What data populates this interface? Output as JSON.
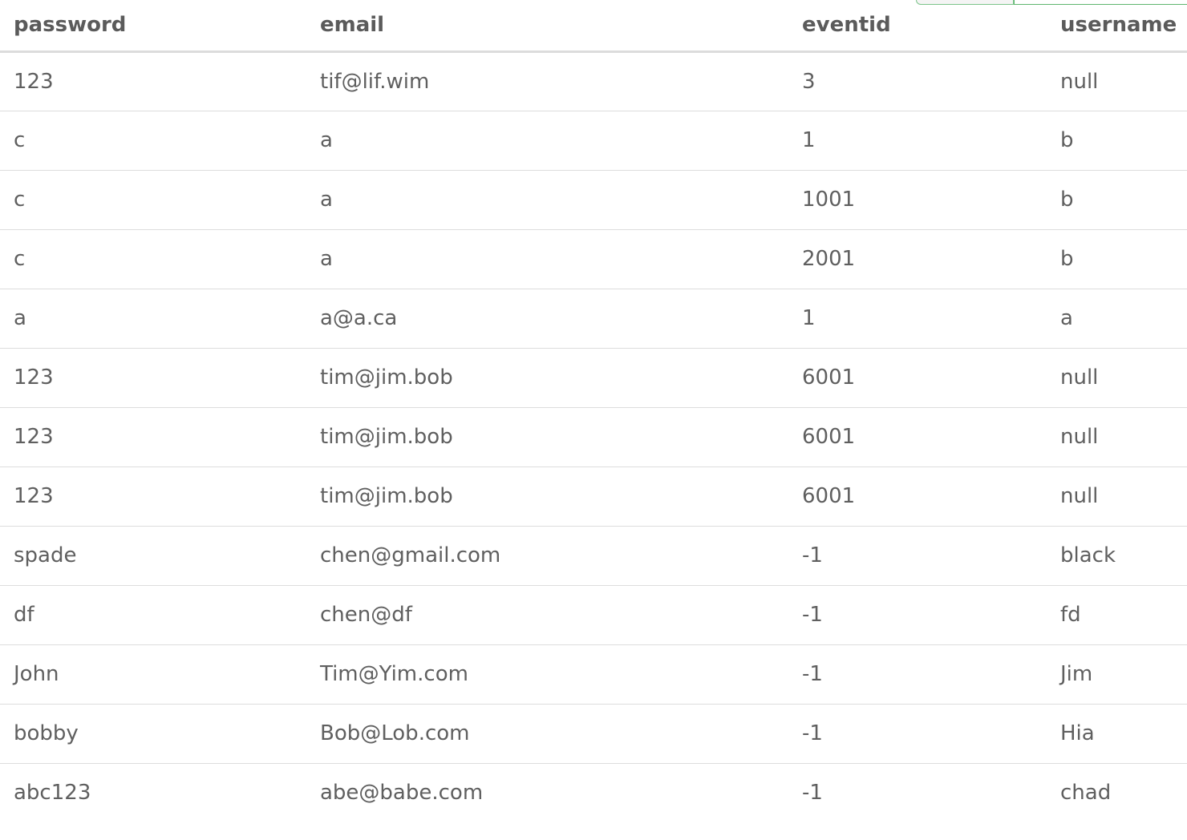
{
  "table": {
    "columns": [
      "password",
      "email",
      "eventid",
      "username"
    ],
    "rows": [
      [
        "123",
        "tif@lif.wim",
        "3",
        "null"
      ],
      [
        "c",
        "a",
        "1",
        "b"
      ],
      [
        "c",
        "a",
        "1001",
        "b"
      ],
      [
        "c",
        "a",
        "2001",
        "b"
      ],
      [
        "a",
        "a@a.ca",
        "1",
        "a"
      ],
      [
        "123",
        "tim@jim.bob",
        "6001",
        "null"
      ],
      [
        "123",
        "tim@jim.bob",
        "6001",
        "null"
      ],
      [
        "123",
        "tim@jim.bob",
        "6001",
        "null"
      ],
      [
        "spade",
        "chen@gmail.com",
        "-1",
        "black"
      ],
      [
        "df",
        "chen@df",
        "-1",
        "fd"
      ],
      [
        "John",
        "Tim@Yim.com",
        "-1",
        "Jim"
      ],
      [
        "bobby",
        "Bob@Lob.com",
        "-1",
        "Hia"
      ],
      [
        "abc123",
        "abe@babe.com",
        "-1",
        "chad"
      ]
    ]
  },
  "colors": {
    "text": "#5f5f5f",
    "header_border": "#dcdcdc",
    "row_border": "#dddddd",
    "tab_accent": "#5fb56f"
  }
}
